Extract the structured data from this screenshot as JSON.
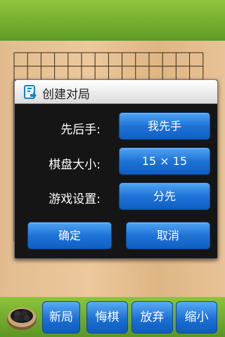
{
  "dialog": {
    "title": "创建对局",
    "rows": [
      {
        "label": "先后手:",
        "value": "我先手"
      },
      {
        "label": "棋盘大小:",
        "value": "15 × 15"
      },
      {
        "label": "游戏设置:",
        "value": "分先"
      }
    ],
    "confirm_label": "确定",
    "cancel_label": "取消"
  },
  "toolbar": {
    "new_game_label": "新局",
    "undo_label": "悔棋",
    "pass_label": "放弃",
    "more_label": "缩小"
  },
  "colors": {
    "button_blue": "#1e73d8",
    "toolbar_green": "#6aa12c",
    "board_wood": "#e6c193"
  }
}
